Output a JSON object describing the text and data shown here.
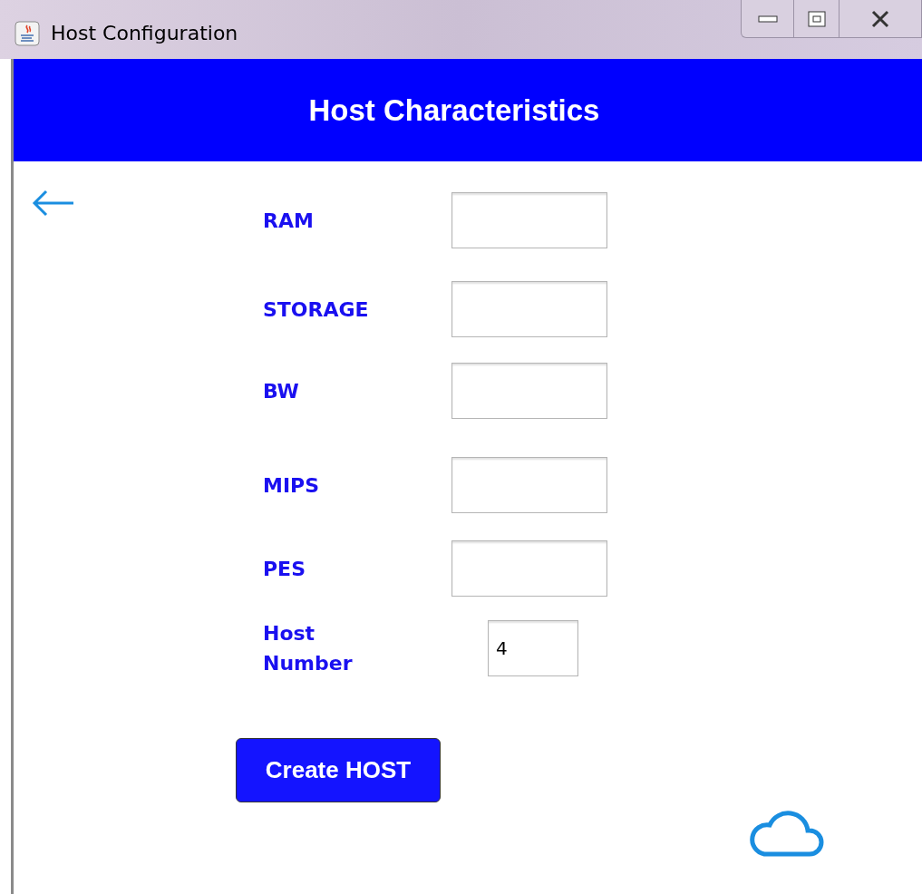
{
  "window": {
    "title": "Host Configuration"
  },
  "header": {
    "title": "Host Characteristics"
  },
  "fields": [
    {
      "label": "RAM",
      "kind": "wide"
    },
    {
      "label": "STORAGE",
      "kind": "wide"
    },
    {
      "label": "BW",
      "kind": "wide"
    },
    {
      "label": "MIPS",
      "kind": "wide"
    },
    {
      "label": "PES",
      "kind": "wide"
    },
    {
      "label": "Host Number",
      "kind": "narrow",
      "value": "4"
    }
  ],
  "buttons": [
    "Create HOST"
  ]
}
